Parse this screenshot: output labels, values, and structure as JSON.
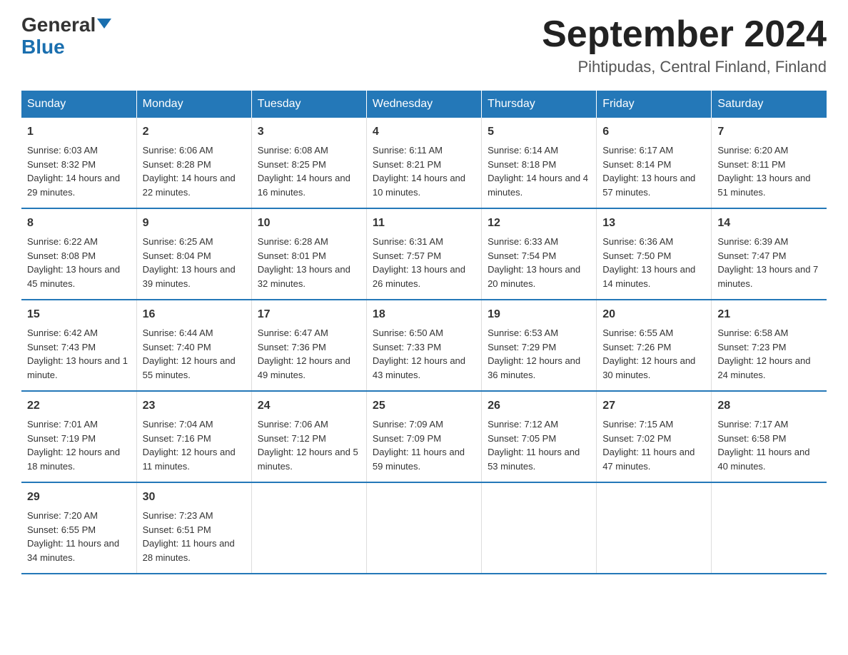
{
  "header": {
    "logo_general": "General",
    "logo_blue": "Blue",
    "month_title": "September 2024",
    "location": "Pihtipudas, Central Finland, Finland"
  },
  "days_of_week": [
    "Sunday",
    "Monday",
    "Tuesday",
    "Wednesday",
    "Thursday",
    "Friday",
    "Saturday"
  ],
  "weeks": [
    [
      {
        "day": "1",
        "sunrise": "Sunrise: 6:03 AM",
        "sunset": "Sunset: 8:32 PM",
        "daylight": "Daylight: 14 hours and 29 minutes."
      },
      {
        "day": "2",
        "sunrise": "Sunrise: 6:06 AM",
        "sunset": "Sunset: 8:28 PM",
        "daylight": "Daylight: 14 hours and 22 minutes."
      },
      {
        "day": "3",
        "sunrise": "Sunrise: 6:08 AM",
        "sunset": "Sunset: 8:25 PM",
        "daylight": "Daylight: 14 hours and 16 minutes."
      },
      {
        "day": "4",
        "sunrise": "Sunrise: 6:11 AM",
        "sunset": "Sunset: 8:21 PM",
        "daylight": "Daylight: 14 hours and 10 minutes."
      },
      {
        "day": "5",
        "sunrise": "Sunrise: 6:14 AM",
        "sunset": "Sunset: 8:18 PM",
        "daylight": "Daylight: 14 hours and 4 minutes."
      },
      {
        "day": "6",
        "sunrise": "Sunrise: 6:17 AM",
        "sunset": "Sunset: 8:14 PM",
        "daylight": "Daylight: 13 hours and 57 minutes."
      },
      {
        "day": "7",
        "sunrise": "Sunrise: 6:20 AM",
        "sunset": "Sunset: 8:11 PM",
        "daylight": "Daylight: 13 hours and 51 minutes."
      }
    ],
    [
      {
        "day": "8",
        "sunrise": "Sunrise: 6:22 AM",
        "sunset": "Sunset: 8:08 PM",
        "daylight": "Daylight: 13 hours and 45 minutes."
      },
      {
        "day": "9",
        "sunrise": "Sunrise: 6:25 AM",
        "sunset": "Sunset: 8:04 PM",
        "daylight": "Daylight: 13 hours and 39 minutes."
      },
      {
        "day": "10",
        "sunrise": "Sunrise: 6:28 AM",
        "sunset": "Sunset: 8:01 PM",
        "daylight": "Daylight: 13 hours and 32 minutes."
      },
      {
        "day": "11",
        "sunrise": "Sunrise: 6:31 AM",
        "sunset": "Sunset: 7:57 PM",
        "daylight": "Daylight: 13 hours and 26 minutes."
      },
      {
        "day": "12",
        "sunrise": "Sunrise: 6:33 AM",
        "sunset": "Sunset: 7:54 PM",
        "daylight": "Daylight: 13 hours and 20 minutes."
      },
      {
        "day": "13",
        "sunrise": "Sunrise: 6:36 AM",
        "sunset": "Sunset: 7:50 PM",
        "daylight": "Daylight: 13 hours and 14 minutes."
      },
      {
        "day": "14",
        "sunrise": "Sunrise: 6:39 AM",
        "sunset": "Sunset: 7:47 PM",
        "daylight": "Daylight: 13 hours and 7 minutes."
      }
    ],
    [
      {
        "day": "15",
        "sunrise": "Sunrise: 6:42 AM",
        "sunset": "Sunset: 7:43 PM",
        "daylight": "Daylight: 13 hours and 1 minute."
      },
      {
        "day": "16",
        "sunrise": "Sunrise: 6:44 AM",
        "sunset": "Sunset: 7:40 PM",
        "daylight": "Daylight: 12 hours and 55 minutes."
      },
      {
        "day": "17",
        "sunrise": "Sunrise: 6:47 AM",
        "sunset": "Sunset: 7:36 PM",
        "daylight": "Daylight: 12 hours and 49 minutes."
      },
      {
        "day": "18",
        "sunrise": "Sunrise: 6:50 AM",
        "sunset": "Sunset: 7:33 PM",
        "daylight": "Daylight: 12 hours and 43 minutes."
      },
      {
        "day": "19",
        "sunrise": "Sunrise: 6:53 AM",
        "sunset": "Sunset: 7:29 PM",
        "daylight": "Daylight: 12 hours and 36 minutes."
      },
      {
        "day": "20",
        "sunrise": "Sunrise: 6:55 AM",
        "sunset": "Sunset: 7:26 PM",
        "daylight": "Daylight: 12 hours and 30 minutes."
      },
      {
        "day": "21",
        "sunrise": "Sunrise: 6:58 AM",
        "sunset": "Sunset: 7:23 PM",
        "daylight": "Daylight: 12 hours and 24 minutes."
      }
    ],
    [
      {
        "day": "22",
        "sunrise": "Sunrise: 7:01 AM",
        "sunset": "Sunset: 7:19 PM",
        "daylight": "Daylight: 12 hours and 18 minutes."
      },
      {
        "day": "23",
        "sunrise": "Sunrise: 7:04 AM",
        "sunset": "Sunset: 7:16 PM",
        "daylight": "Daylight: 12 hours and 11 minutes."
      },
      {
        "day": "24",
        "sunrise": "Sunrise: 7:06 AM",
        "sunset": "Sunset: 7:12 PM",
        "daylight": "Daylight: 12 hours and 5 minutes."
      },
      {
        "day": "25",
        "sunrise": "Sunrise: 7:09 AM",
        "sunset": "Sunset: 7:09 PM",
        "daylight": "Daylight: 11 hours and 59 minutes."
      },
      {
        "day": "26",
        "sunrise": "Sunrise: 7:12 AM",
        "sunset": "Sunset: 7:05 PM",
        "daylight": "Daylight: 11 hours and 53 minutes."
      },
      {
        "day": "27",
        "sunrise": "Sunrise: 7:15 AM",
        "sunset": "Sunset: 7:02 PM",
        "daylight": "Daylight: 11 hours and 47 minutes."
      },
      {
        "day": "28",
        "sunrise": "Sunrise: 7:17 AM",
        "sunset": "Sunset: 6:58 PM",
        "daylight": "Daylight: 11 hours and 40 minutes."
      }
    ],
    [
      {
        "day": "29",
        "sunrise": "Sunrise: 7:20 AM",
        "sunset": "Sunset: 6:55 PM",
        "daylight": "Daylight: 11 hours and 34 minutes."
      },
      {
        "day": "30",
        "sunrise": "Sunrise: 7:23 AM",
        "sunset": "Sunset: 6:51 PM",
        "daylight": "Daylight: 11 hours and 28 minutes."
      },
      null,
      null,
      null,
      null,
      null
    ]
  ]
}
